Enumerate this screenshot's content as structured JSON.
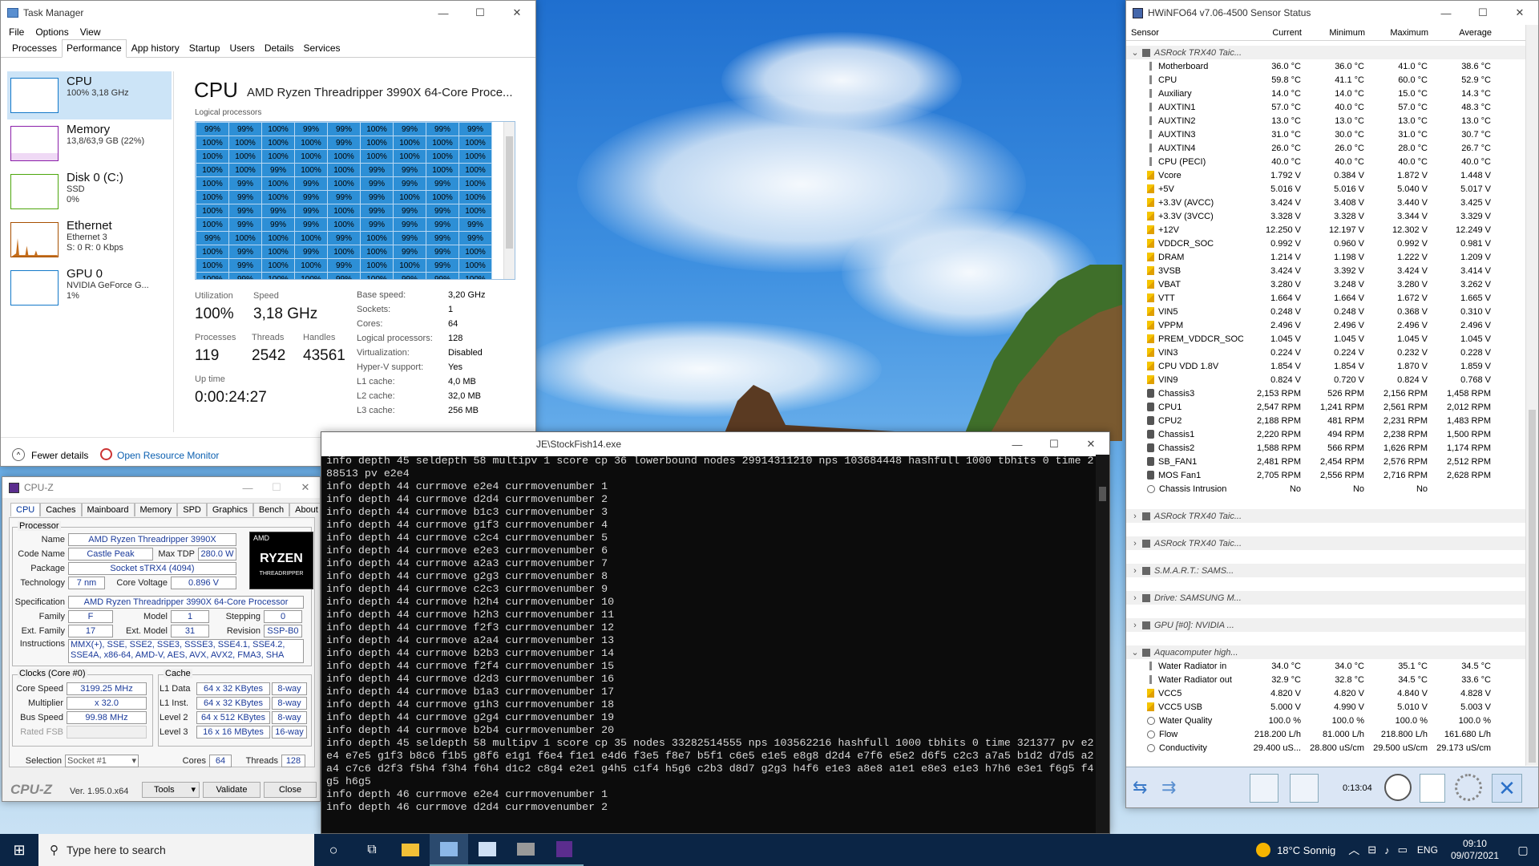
{
  "taskmgr": {
    "title": "Task Manager",
    "menu": [
      "File",
      "Options",
      "View"
    ],
    "tabs": [
      "Processes",
      "Performance",
      "App history",
      "Startup",
      "Users",
      "Details",
      "Services"
    ],
    "side": [
      {
        "name": "CPU",
        "sub": "100% 3,18 GHz",
        "sub2": ""
      },
      {
        "name": "Memory",
        "sub": "13,8/63,9 GB (22%)",
        "sub2": ""
      },
      {
        "name": "Disk 0 (C:)",
        "sub": "SSD",
        "sub2": "0%"
      },
      {
        "name": "Ethernet",
        "sub": "Ethernet 3",
        "sub2": "S: 0 R: 0 Kbps"
      },
      {
        "name": "GPU 0",
        "sub": "NVIDIA GeForce G...",
        "sub2": "1%"
      }
    ],
    "heading": "CPU",
    "model": "AMD Ryzen Threadripper 3990X 64-Core Proce...",
    "lp_label": "Logical processors",
    "grid": [
      [
        "99%",
        "99%",
        "100%",
        "99%",
        "99%",
        "100%",
        "99%",
        "99%",
        "99%"
      ],
      [
        "100%",
        "100%",
        "100%",
        "100%",
        "99%",
        "100%",
        "100%",
        "100%",
        "100%"
      ],
      [
        "100%",
        "100%",
        "100%",
        "100%",
        "100%",
        "100%",
        "100%",
        "100%",
        "100%"
      ],
      [
        "100%",
        "100%",
        "99%",
        "100%",
        "100%",
        "99%",
        "99%",
        "100%",
        "100%"
      ],
      [
        "100%",
        "99%",
        "100%",
        "99%",
        "100%",
        "99%",
        "99%",
        "99%",
        "100%"
      ],
      [
        "100%",
        "99%",
        "100%",
        "99%",
        "99%",
        "99%",
        "100%",
        "100%",
        "100%"
      ],
      [
        "100%",
        "99%",
        "99%",
        "99%",
        "100%",
        "99%",
        "99%",
        "99%",
        "100%"
      ],
      [
        "100%",
        "99%",
        "99%",
        "99%",
        "100%",
        "99%",
        "99%",
        "99%",
        "99%"
      ],
      [
        "99%",
        "100%",
        "100%",
        "100%",
        "99%",
        "100%",
        "99%",
        "99%",
        "99%"
      ],
      [
        "100%",
        "99%",
        "100%",
        "99%",
        "100%",
        "100%",
        "99%",
        "99%",
        "100%"
      ],
      [
        "100%",
        "99%",
        "100%",
        "100%",
        "99%",
        "100%",
        "100%",
        "99%",
        "100%"
      ],
      [
        "100%",
        "99%",
        "100%",
        "100%",
        "99%",
        "100%",
        "99%",
        "99%",
        "100%"
      ]
    ],
    "stats": {
      "util_l": "Utilization",
      "util": "100%",
      "speed_l": "Speed",
      "speed": "3,18 GHz",
      "proc_l": "Processes",
      "proc": "119",
      "thr_l": "Threads",
      "thr": "2542",
      "han_l": "Handles",
      "han": "43561",
      "up_l": "Up time",
      "up": "0:00:24:27"
    },
    "specs": [
      [
        "Base speed:",
        "3,20 GHz"
      ],
      [
        "Sockets:",
        "1"
      ],
      [
        "Cores:",
        "64"
      ],
      [
        "Logical processors:",
        "128"
      ],
      [
        "Virtualization:",
        "Disabled"
      ],
      [
        "Hyper-V support:",
        "Yes"
      ],
      [
        "L1 cache:",
        "4,0 MB"
      ],
      [
        "L2 cache:",
        "32,0 MB"
      ],
      [
        "L3 cache:",
        "256 MB"
      ]
    ],
    "fewer": "Fewer details",
    "orm": "Open Resource Monitor"
  },
  "cpuz": {
    "title": "CPU-Z",
    "tabs": [
      "CPU",
      "Caches",
      "Mainboard",
      "Memory",
      "SPD",
      "Graphics",
      "Bench",
      "About"
    ],
    "processor": "Processor",
    "name_l": "Name",
    "name": "AMD Ryzen Threadripper 3990X",
    "code_l": "Code Name",
    "code": "Castle Peak",
    "tdp_l": "Max TDP",
    "tdp": "280.0 W",
    "pkg_l": "Package",
    "pkg": "Socket sTRX4 (4094)",
    "tech_l": "Technology",
    "tech": "7 nm",
    "cv_l": "Core Voltage",
    "cv": "0.896 V",
    "spec_l": "Specification",
    "spec": "AMD Ryzen Threadripper 3990X 64-Core Processor",
    "fam_l": "Family",
    "fam": "F",
    "mod_l": "Model",
    "mod": "1",
    "step_l": "Stepping",
    "step": "0",
    "efam_l": "Ext. Family",
    "efam": "17",
    "emod_l": "Ext. Model",
    "emod": "31",
    "rev_l": "Revision",
    "rev": "SSP-B0",
    "ins_l": "Instructions",
    "ins": "MMX(+), SSE, SSE2, SSE3, SSSE3, SSE4.1, SSE4.2, SSE4A, x86-64, AMD-V, AES, AVX, AVX2, FMA3, SHA",
    "clocks": "Clocks (Core #0)",
    "cs_l": "Core Speed",
    "cs": "3199.25 MHz",
    "mul_l": "Multiplier",
    "mul": "x 32.0",
    "bus_l": "Bus Speed",
    "bus": "99.98 MHz",
    "fsb_l": "Rated FSB",
    "cache": "Cache",
    "l1d_l": "L1 Data",
    "l1d": "64 x 32 KBytes",
    "l1d_w": "8-way",
    "l1i_l": "L1 Inst.",
    "l1i": "64 x 32 KBytes",
    "l1i_w": "8-way",
    "l2_l": "Level 2",
    "l2": "64 x 512 KBytes",
    "l2_w": "8-way",
    "l3_l": "Level 3",
    "l3": "16 x 16 MBytes",
    "l3_w": "16-way",
    "sel_l": "Selection",
    "sel": "Socket #1",
    "cores_l": "Cores",
    "cores": "64",
    "thr_l": "Threads",
    "thr": "128",
    "brand": "CPU-Z",
    "ver": "Ver. 1.95.0.x64",
    "tools": "Tools",
    "validate": "Validate",
    "close": "Close",
    "logo1": "AMD",
    "logo2": "RYZEN",
    "logo3": "THREADRIPPER"
  },
  "console": {
    "title": "JE\\StockFish14.exe",
    "lines": [
      "info depth 45 seldepth 58 multipv 1 score cp 36 lowerbound nodes 29914311210 nps 103684448 hashfull 1000 tbhits 0 time 2",
      "88513 pv e2e4",
      "info depth 44 currmove e2e4 currmovenumber 1",
      "info depth 44 currmove d2d4 currmovenumber 2",
      "info depth 44 currmove b1c3 currmovenumber 3",
      "info depth 44 currmove g1f3 currmovenumber 4",
      "info depth 44 currmove c2c4 currmovenumber 5",
      "info depth 44 currmove e2e3 currmovenumber 6",
      "info depth 44 currmove a2a3 currmovenumber 7",
      "info depth 44 currmove g2g3 currmovenumber 8",
      "info depth 44 currmove c2c3 currmovenumber 9",
      "info depth 44 currmove h2h4 currmovenumber 10",
      "info depth 44 currmove h2h3 currmovenumber 11",
      "info depth 44 currmove f2f3 currmovenumber 12",
      "info depth 44 currmove a2a4 currmovenumber 13",
      "info depth 44 currmove b2b3 currmovenumber 14",
      "info depth 44 currmove f2f4 currmovenumber 15",
      "info depth 44 currmove d2d3 currmovenumber 16",
      "info depth 44 currmove b1a3 currmovenumber 17",
      "info depth 44 currmove g1h3 currmovenumber 18",
      "info depth 44 currmove g2g4 currmovenumber 19",
      "info depth 44 currmove b2b4 currmovenumber 20",
      "info depth 45 seldepth 58 multipv 1 score cp 35 nodes 33282514555 nps 103562216 hashfull 1000 tbhits 0 time 321377 pv e2",
      "e4 e7e5 g1f3 b8c6 f1b5 g8f6 e1g1 f6e4 f1e1 e4d6 f3e5 f8e7 b5f1 c6e5 e1e5 e8g8 d2d4 e7f6 e5e2 d6f5 c2c3 a7a5 b1d2 d7d5 a2",
      "a4 c7c6 d2f3 f5h4 f3h4 f6h4 d1c2 c8g4 e2e1 g4h5 c1f4 h5g6 c2b3 d8d7 g2g3 h4f6 e1e3 a8e8 a1e1 e8e3 e1e3 h7h6 e3e1 f6g5 f4",
      "g5 h6g5",
      "info depth 46 currmove e2e4 currmovenumber 1",
      "info depth 46 currmove d2d4 currmovenumber 2"
    ]
  },
  "hwinfo": {
    "title": "HWiNFO64 v7.06-4500 Sensor Status",
    "cols": [
      "Sensor",
      "Current",
      "Minimum",
      "Maximum",
      "Average"
    ],
    "rows": [
      {
        "k": "g",
        "n": "ASRock TRX40 Taic...",
        "c": "",
        "mi": "",
        "ma": "",
        "av": ""
      },
      {
        "k": "t",
        "n": "Motherboard",
        "c": "36.0 °C",
        "mi": "36.0 °C",
        "ma": "41.0 °C",
        "av": "38.6 °C"
      },
      {
        "k": "t",
        "n": "CPU",
        "c": "59.8 °C",
        "mi": "41.1 °C",
        "ma": "60.0 °C",
        "av": "52.9 °C"
      },
      {
        "k": "t",
        "n": "Auxiliary",
        "c": "14.0 °C",
        "mi": "14.0 °C",
        "ma": "15.0 °C",
        "av": "14.3 °C"
      },
      {
        "k": "t",
        "n": "AUXTIN1",
        "c": "57.0 °C",
        "mi": "40.0 °C",
        "ma": "57.0 °C",
        "av": "48.3 °C"
      },
      {
        "k": "t",
        "n": "AUXTIN2",
        "c": "13.0 °C",
        "mi": "13.0 °C",
        "ma": "13.0 °C",
        "av": "13.0 °C"
      },
      {
        "k": "t",
        "n": "AUXTIN3",
        "c": "31.0 °C",
        "mi": "30.0 °C",
        "ma": "31.0 °C",
        "av": "30.7 °C"
      },
      {
        "k": "t",
        "n": "AUXTIN4",
        "c": "26.0 °C",
        "mi": "26.0 °C",
        "ma": "28.0 °C",
        "av": "26.7 °C"
      },
      {
        "k": "t",
        "n": "CPU (PECI)",
        "c": "40.0 °C",
        "mi": "40.0 °C",
        "ma": "40.0 °C",
        "av": "40.0 °C"
      },
      {
        "k": "v",
        "n": "Vcore",
        "c": "1.792 V",
        "mi": "0.384 V",
        "ma": "1.872 V",
        "av": "1.448 V"
      },
      {
        "k": "v",
        "n": "+5V",
        "c": "5.016 V",
        "mi": "5.016 V",
        "ma": "5.040 V",
        "av": "5.017 V"
      },
      {
        "k": "v",
        "n": "+3.3V (AVCC)",
        "c": "3.424 V",
        "mi": "3.408 V",
        "ma": "3.440 V",
        "av": "3.425 V"
      },
      {
        "k": "v",
        "n": "+3.3V (3VCC)",
        "c": "3.328 V",
        "mi": "3.328 V",
        "ma": "3.344 V",
        "av": "3.329 V"
      },
      {
        "k": "v",
        "n": "+12V",
        "c": "12.250 V",
        "mi": "12.197 V",
        "ma": "12.302 V",
        "av": "12.249 V"
      },
      {
        "k": "v",
        "n": "VDDCR_SOC",
        "c": "0.992 V",
        "mi": "0.960 V",
        "ma": "0.992 V",
        "av": "0.981 V"
      },
      {
        "k": "v",
        "n": "DRAM",
        "c": "1.214 V",
        "mi": "1.198 V",
        "ma": "1.222 V",
        "av": "1.209 V"
      },
      {
        "k": "v",
        "n": "3VSB",
        "c": "3.424 V",
        "mi": "3.392 V",
        "ma": "3.424 V",
        "av": "3.414 V"
      },
      {
        "k": "v",
        "n": "VBAT",
        "c": "3.280 V",
        "mi": "3.248 V",
        "ma": "3.280 V",
        "av": "3.262 V"
      },
      {
        "k": "v",
        "n": "VTT",
        "c": "1.664 V",
        "mi": "1.664 V",
        "ma": "1.672 V",
        "av": "1.665 V"
      },
      {
        "k": "v",
        "n": "VIN5",
        "c": "0.248 V",
        "mi": "0.248 V",
        "ma": "0.368 V",
        "av": "0.310 V"
      },
      {
        "k": "v",
        "n": "VPPM",
        "c": "2.496 V",
        "mi": "2.496 V",
        "ma": "2.496 V",
        "av": "2.496 V"
      },
      {
        "k": "v",
        "n": "PREM_VDDCR_SOC",
        "c": "1.045 V",
        "mi": "1.045 V",
        "ma": "1.045 V",
        "av": "1.045 V"
      },
      {
        "k": "v",
        "n": "VIN3",
        "c": "0.224 V",
        "mi": "0.224 V",
        "ma": "0.232 V",
        "av": "0.228 V"
      },
      {
        "k": "v",
        "n": "CPU VDD 1.8V",
        "c": "1.854 V",
        "mi": "1.854 V",
        "ma": "1.870 V",
        "av": "1.859 V"
      },
      {
        "k": "v",
        "n": "VIN9",
        "c": "0.824 V",
        "mi": "0.720 V",
        "ma": "0.824 V",
        "av": "0.768 V"
      },
      {
        "k": "f",
        "n": "Chassis3",
        "c": "2,153 RPM",
        "mi": "526 RPM",
        "ma": "2,156 RPM",
        "av": "1,458 RPM"
      },
      {
        "k": "f",
        "n": "CPU1",
        "c": "2,547 RPM",
        "mi": "1,241 RPM",
        "ma": "2,561 RPM",
        "av": "2,012 RPM"
      },
      {
        "k": "f",
        "n": "CPU2",
        "c": "2,188 RPM",
        "mi": "481 RPM",
        "ma": "2,231 RPM",
        "av": "1,483 RPM"
      },
      {
        "k": "f",
        "n": "Chassis1",
        "c": "2,220 RPM",
        "mi": "494 RPM",
        "ma": "2,238 RPM",
        "av": "1,500 RPM"
      },
      {
        "k": "f",
        "n": "Chassis2",
        "c": "1,588 RPM",
        "mi": "566 RPM",
        "ma": "1,626 RPM",
        "av": "1,174 RPM"
      },
      {
        "k": "f",
        "n": "SB_FAN1",
        "c": "2,481 RPM",
        "mi": "2,454 RPM",
        "ma": "2,576 RPM",
        "av": "2,512 RPM"
      },
      {
        "k": "f",
        "n": "MOS Fan1",
        "c": "2,705 RPM",
        "mi": "2,556 RPM",
        "ma": "2,716 RPM",
        "av": "2,628 RPM"
      },
      {
        "k": "o",
        "n": "Chassis Intrusion",
        "c": "No",
        "mi": "No",
        "ma": "No",
        "av": ""
      },
      {
        "k": "s",
        "n": "",
        "c": "",
        "mi": "",
        "ma": "",
        "av": ""
      },
      {
        "k": "gc",
        "n": "ASRock TRX40 Taic...",
        "c": "",
        "mi": "",
        "ma": "",
        "av": ""
      },
      {
        "k": "s",
        "n": "",
        "c": "",
        "mi": "",
        "ma": "",
        "av": ""
      },
      {
        "k": "gc",
        "n": "ASRock TRX40 Taic...",
        "c": "",
        "mi": "",
        "ma": "",
        "av": ""
      },
      {
        "k": "s",
        "n": "",
        "c": "",
        "mi": "",
        "ma": "",
        "av": ""
      },
      {
        "k": "gc",
        "n": "S.M.A.R.T.: SAMS...",
        "c": "",
        "mi": "",
        "ma": "",
        "av": ""
      },
      {
        "k": "s",
        "n": "",
        "c": "",
        "mi": "",
        "ma": "",
        "av": ""
      },
      {
        "k": "gc",
        "n": "Drive: SAMSUNG M...",
        "c": "",
        "mi": "",
        "ma": "",
        "av": ""
      },
      {
        "k": "s",
        "n": "",
        "c": "",
        "mi": "",
        "ma": "",
        "av": ""
      },
      {
        "k": "gc",
        "n": "GPU [#0]: NVIDIA ...",
        "c": "",
        "mi": "",
        "ma": "",
        "av": ""
      },
      {
        "k": "s",
        "n": "",
        "c": "",
        "mi": "",
        "ma": "",
        "av": ""
      },
      {
        "k": "g",
        "n": "Aquacomputer high...",
        "c": "",
        "mi": "",
        "ma": "",
        "av": ""
      },
      {
        "k": "t",
        "n": "Water Radiator in",
        "c": "34.0 °C",
        "mi": "34.0 °C",
        "ma": "35.1 °C",
        "av": "34.5 °C"
      },
      {
        "k": "t",
        "n": "Water Radiator out",
        "c": "32.9 °C",
        "mi": "32.8 °C",
        "ma": "34.5 °C",
        "av": "33.6 °C"
      },
      {
        "k": "v",
        "n": "VCC5",
        "c": "4.820 V",
        "mi": "4.820 V",
        "ma": "4.840 V",
        "av": "4.828 V"
      },
      {
        "k": "v",
        "n": "VCC5 USB",
        "c": "5.000 V",
        "mi": "4.990 V",
        "ma": "5.010 V",
        "av": "5.003 V"
      },
      {
        "k": "o",
        "n": "Water Quality",
        "c": "100.0 %",
        "mi": "100.0 %",
        "ma": "100.0 %",
        "av": "100.0 %"
      },
      {
        "k": "o",
        "n": "Flow",
        "c": "218.200 L/h",
        "mi": "81.000 L/h",
        "ma": "218.800 L/h",
        "av": "161.680 L/h"
      },
      {
        "k": "o",
        "n": "Conductivity",
        "c": "29.400 uS...",
        "mi": "28.800 uS/cm",
        "ma": "29.500 uS/cm",
        "av": "29.173 uS/cm"
      }
    ],
    "timer": "0:13:04"
  },
  "taskbar": {
    "search": "Type here to search",
    "weather": "18°C Sonnig",
    "lang": "ENG",
    "time": "09:10",
    "date": "09/07/2021"
  }
}
